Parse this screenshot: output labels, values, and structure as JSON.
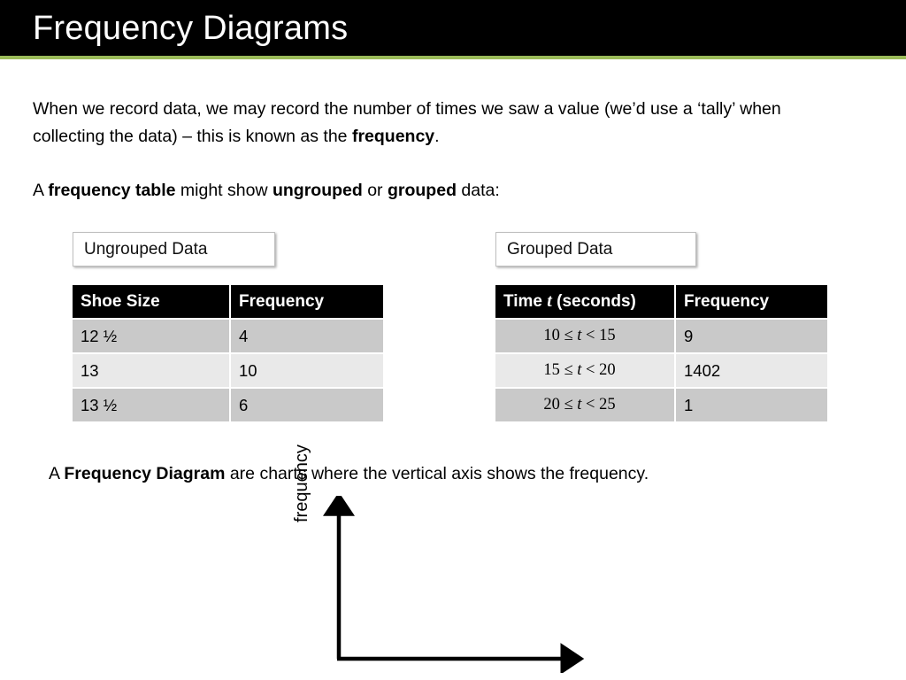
{
  "slide": {
    "title": "Frequency Diagrams",
    "accent_color": "#9bbb59",
    "title_bar_color": "#000000",
    "background_color": "#ffffff"
  },
  "paragraphs": {
    "intro_part1": "When we record data, we may record the number of times we saw a value (we’d use a ‘tally’ when collecting the data) – this is known as the ",
    "intro_bold": "frequency",
    "intro_part2": ".",
    "tables_lead_a": "A ",
    "tables_lead_bold1": "frequency table",
    "tables_lead_b": " might show ",
    "tables_lead_bold2": "ungrouped",
    "tables_lead_c": " or ",
    "tables_lead_bold3": "grouped",
    "tables_lead_d": " data:",
    "diagram_lead_a": "A ",
    "diagram_lead_bold": "Frequency Diagram",
    "diagram_lead_b": " are charts where the vertical axis shows the frequency."
  },
  "captions": {
    "ungrouped": "Ungrouped Data",
    "grouped": "Grouped Data"
  },
  "ungrouped_table": {
    "headers": [
      "Shoe Size",
      "Frequency"
    ],
    "rows": [
      [
        "12 ½",
        "4"
      ],
      [
        "13",
        "10"
      ],
      [
        "13 ½",
        "6"
      ]
    ]
  },
  "grouped_table": {
    "header_prefix": "Time ",
    "header_variable": "t",
    "header_suffix": " (seconds)",
    "header_frequency": "Frequency",
    "rows": [
      {
        "interval_lower": "10 ≤ ",
        "interval_var": "t",
        "interval_upper": " < 15",
        "frequency": "9"
      },
      {
        "interval_lower": "15 ≤ ",
        "interval_var": "t",
        "interval_upper": " < 20",
        "frequency": "1402"
      },
      {
        "interval_lower": "20 ≤ ",
        "interval_var": "t",
        "interval_upper": " < 25",
        "frequency": "1"
      }
    ]
  },
  "axis_diagram": {
    "y_axis_label": "frequency",
    "x_axis_label": "",
    "line_color": "#000000"
  }
}
